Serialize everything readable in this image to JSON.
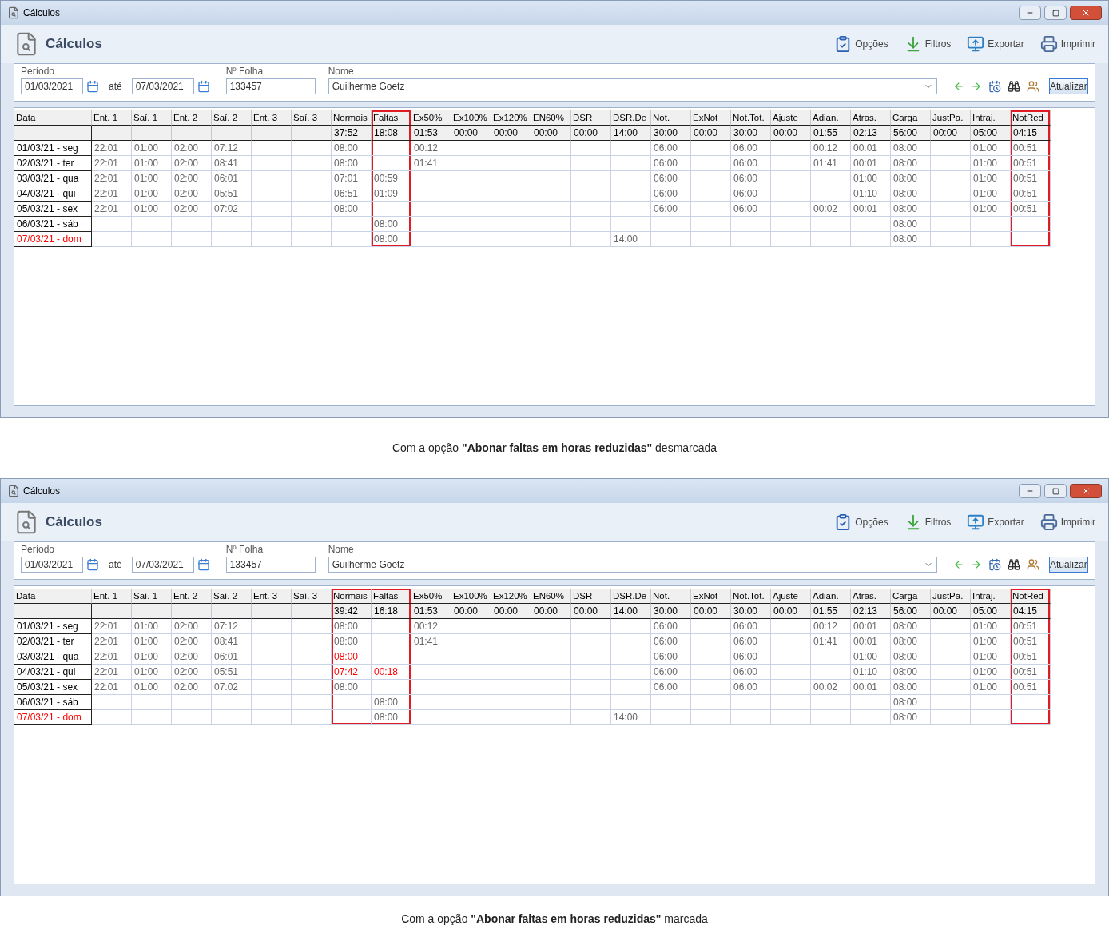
{
  "panels": [
    {
      "window": {
        "title": "Cálculos"
      },
      "header": {
        "title": "Cálculos"
      },
      "toolbar": [
        {
          "label": "Opções"
        },
        {
          "label": "Filtros"
        },
        {
          "label": "Exportar"
        },
        {
          "label": "Imprimir"
        }
      ],
      "filters": {
        "period_label": "Período",
        "start": "01/03/2021",
        "until": "até",
        "end": "07/03/2021",
        "sheet_label": "Nº Folha",
        "sheet": "133457",
        "name_label": "Nome",
        "name": "Guilherme Goetz"
      },
      "update_button": "Atualizar",
      "table": {
        "columns": [
          {
            "label": "Data",
            "highlighted": false
          },
          {
            "label": "Ent. 1",
            "highlighted": false
          },
          {
            "label": "Saí. 1",
            "highlighted": false
          },
          {
            "label": "Ent. 2",
            "highlighted": false
          },
          {
            "label": "Saí. 2",
            "highlighted": false
          },
          {
            "label": "Ent. 3",
            "highlighted": false
          },
          {
            "label": "Saí. 3",
            "highlighted": false
          },
          {
            "label": "Normais",
            "highlighted": false
          },
          {
            "label": "Faltas",
            "highlighted": true
          },
          {
            "label": "Ex50%",
            "highlighted": false
          },
          {
            "label": "Ex100%",
            "highlighted": false
          },
          {
            "label": "Ex120%",
            "highlighted": false
          },
          {
            "label": "EN60%",
            "highlighted": false
          },
          {
            "label": "DSR",
            "highlighted": false
          },
          {
            "label": "DSR.De",
            "highlighted": false
          },
          {
            "label": "Not.",
            "highlighted": false
          },
          {
            "label": "ExNot",
            "highlighted": false
          },
          {
            "label": "Not.Tot.",
            "highlighted": false
          },
          {
            "label": "Ajuste",
            "highlighted": false
          },
          {
            "label": "Adian.",
            "highlighted": false
          },
          {
            "label": "Atras.",
            "highlighted": false
          },
          {
            "label": "Carga",
            "highlighted": false
          },
          {
            "label": "JustPa.",
            "highlighted": false
          },
          {
            "label": "Intraj.",
            "highlighted": false
          },
          {
            "label": "NotRed",
            "highlighted": true
          }
        ],
        "totals": [
          "37:52",
          "18:08",
          "01:53",
          "00:00",
          "00:00",
          "00:00",
          "00:00",
          "14:00",
          "30:00",
          "00:00",
          "30:00",
          "00:00",
          "01:55",
          "02:13",
          "56:00",
          "00:00",
          "05:00",
          "04:15"
        ],
        "rows": [
          {
            "cells": [
              "01/03/21 - seg",
              "22:01",
              "01:00",
              "02:00",
              "07:12",
              "",
              "",
              "08:00",
              "",
              "00:12",
              "",
              "",
              "",
              "",
              "",
              "06:00",
              "",
              "06:00",
              "",
              "00:12",
              "00:01",
              "08:00",
              "",
              "01:00",
              "00:51"
            ]
          },
          {
            "cells": [
              "02/03/21 - ter",
              "22:01",
              "01:00",
              "02:00",
              "08:41",
              "",
              "",
              "08:00",
              "",
              "01:41",
              "",
              "",
              "",
              "",
              "",
              "06:00",
              "",
              "06:00",
              "",
              "01:41",
              "00:01",
              "08:00",
              "",
              "01:00",
              "00:51"
            ]
          },
          {
            "cells": [
              "03/03/21 - qua",
              "22:01",
              "01:00",
              "02:00",
              "06:01",
              "",
              "",
              "07:01",
              "00:59",
              "",
              "",
              "",
              "",
              "",
              "",
              "06:00",
              "",
              "06:00",
              "",
              "",
              "01:00",
              "08:00",
              "",
              "01:00",
              "00:51"
            ]
          },
          {
            "cells": [
              "04/03/21 - qui",
              "22:01",
              "01:00",
              "02:00",
              "05:51",
              "",
              "",
              "06:51",
              "01:09",
              "",
              "",
              "",
              "",
              "",
              "",
              "06:00",
              "",
              "06:00",
              "",
              "",
              "01:10",
              "08:00",
              "",
              "01:00",
              "00:51"
            ]
          },
          {
            "cells": [
              "05/03/21 - sex",
              "22:01",
              "01:00",
              "02:00",
              "07:02",
              "",
              "",
              "08:00",
              "",
              "",
              "",
              "",
              "",
              "",
              "",
              "06:00",
              "",
              "06:00",
              "",
              "00:02",
              "00:01",
              "08:00",
              "",
              "01:00",
              "00:51"
            ]
          },
          {
            "cells": [
              "06/03/21 - sáb",
              "",
              "",
              "",
              "",
              "",
              "",
              "",
              "08:00",
              "",
              "",
              "",
              "",
              "",
              "",
              "",
              "",
              "",
              "",
              "",
              "",
              "08:00",
              "",
              "",
              ""
            ]
          },
          {
            "cells": [
              {
                "text": "07/03/21 - dom",
                "alert": true
              },
              "",
              "",
              "",
              "",
              "",
              "",
              "",
              "08:00",
              "",
              "",
              "",
              "",
              "",
              "14:00",
              "",
              "",
              "",
              "",
              "",
              "",
              "08:00",
              "",
              "",
              ""
            ]
          }
        ]
      },
      "caption": "Com a opção **\"Abonar faltas em horas reduzidas\"** desmarcada"
    },
    {
      "window": {
        "title": "Cálculos"
      },
      "header": {
        "title": "Cálculos"
      },
      "toolbar": [
        {
          "label": "Opções"
        },
        {
          "label": "Filtros"
        },
        {
          "label": "Exportar"
        },
        {
          "label": "Imprimir"
        }
      ],
      "filters": {
        "period_label": "Período",
        "start": "01/03/2021",
        "until": "até",
        "end": "07/03/2021",
        "sheet_label": "Nº Folha",
        "sheet": "133457",
        "name_label": "Nome",
        "name": "Guilherme Goetz"
      },
      "update_button": "Atualizar",
      "table": {
        "columns": [
          {
            "label": "Data",
            "highlighted": false
          },
          {
            "label": "Ent. 1",
            "highlighted": false
          },
          {
            "label": "Saí. 1",
            "highlighted": false
          },
          {
            "label": "Ent. 2",
            "highlighted": false
          },
          {
            "label": "Saí. 2",
            "highlighted": false
          },
          {
            "label": "Ent. 3",
            "highlighted": false
          },
          {
            "label": "Saí. 3",
            "highlighted": false
          },
          {
            "label": "Normais",
            "highlighted": true
          },
          {
            "label": "Faltas",
            "highlighted": true
          },
          {
            "label": "Ex50%",
            "highlighted": false
          },
          {
            "label": "Ex100%",
            "highlighted": false
          },
          {
            "label": "Ex120%",
            "highlighted": false
          },
          {
            "label": "EN60%",
            "highlighted": false
          },
          {
            "label": "DSR",
            "highlighted": false
          },
          {
            "label": "DSR.De",
            "highlighted": false
          },
          {
            "label": "Not.",
            "highlighted": false
          },
          {
            "label": "ExNot",
            "highlighted": false
          },
          {
            "label": "Not.Tot.",
            "highlighted": false
          },
          {
            "label": "Ajuste",
            "highlighted": false
          },
          {
            "label": "Adian.",
            "highlighted": false
          },
          {
            "label": "Atras.",
            "highlighted": false
          },
          {
            "label": "Carga",
            "highlighted": false
          },
          {
            "label": "JustPa.",
            "highlighted": false
          },
          {
            "label": "Intraj.",
            "highlighted": false
          },
          {
            "label": "NotRed",
            "highlighted": true
          }
        ],
        "totals": [
          "39:42",
          "16:18",
          "01:53",
          "00:00",
          "00:00",
          "00:00",
          "00:00",
          "14:00",
          "30:00",
          "00:00",
          "30:00",
          "00:00",
          "01:55",
          "02:13",
          "56:00",
          "00:00",
          "05:00",
          "04:15"
        ],
        "rows": [
          {
            "cells": [
              "01/03/21 - seg",
              "22:01",
              "01:00",
              "02:00",
              "07:12",
              "",
              "",
              "08:00",
              "",
              "00:12",
              "",
              "",
              "",
              "",
              "",
              "06:00",
              "",
              "06:00",
              "",
              "00:12",
              "00:01",
              "08:00",
              "",
              "01:00",
              "00:51"
            ]
          },
          {
            "cells": [
              "02/03/21 - ter",
              "22:01",
              "01:00",
              "02:00",
              "08:41",
              "",
              "",
              "08:00",
              "",
              "01:41",
              "",
              "",
              "",
              "",
              "",
              "06:00",
              "",
              "06:00",
              "",
              "01:41",
              "00:01",
              "08:00",
              "",
              "01:00",
              "00:51"
            ]
          },
          {
            "cells": [
              "03/03/21 - qua",
              "22:01",
              "01:00",
              "02:00",
              "06:01",
              "",
              "",
              {
                "text": "08:00",
                "alert": true
              },
              "",
              "",
              "",
              "",
              "",
              "",
              "",
              "06:00",
              "",
              "06:00",
              "",
              "",
              "01:00",
              "08:00",
              "",
              "01:00",
              "00:51"
            ]
          },
          {
            "cells": [
              "04/03/21 - qui",
              "22:01",
              "01:00",
              "02:00",
              "05:51",
              "",
              "",
              {
                "text": "07:42",
                "alert": true
              },
              {
                "text": "00:18",
                "alert": true
              },
              "",
              "",
              "",
              "",
              "",
              "",
              "06:00",
              "",
              "06:00",
              "",
              "",
              "01:10",
              "08:00",
              "",
              "01:00",
              "00:51"
            ]
          },
          {
            "cells": [
              "05/03/21 - sex",
              "22:01",
              "01:00",
              "02:00",
              "07:02",
              "",
              "",
              "08:00",
              "",
              "",
              "",
              "",
              "",
              "",
              "",
              "06:00",
              "",
              "06:00",
              "",
              "00:02",
              "00:01",
              "08:00",
              "",
              "01:00",
              "00:51"
            ]
          },
          {
            "cells": [
              "06/03/21 - sáb",
              "",
              "",
              "",
              "",
              "",
              "",
              "",
              "08:00",
              "",
              "",
              "",
              "",
              "",
              "",
              "",
              "",
              "",
              "",
              "",
              "",
              "08:00",
              "",
              "",
              ""
            ]
          },
          {
            "cells": [
              {
                "text": "07/03/21 - dom",
                "alert": true
              },
              "",
              "",
              "",
              "",
              "",
              "",
              "",
              "08:00",
              "",
              "",
              "",
              "",
              "",
              "14:00",
              "",
              "",
              "",
              "",
              "",
              "",
              "08:00",
              "",
              "",
              ""
            ]
          }
        ]
      },
      "caption": "Com a opção **\"Abonar faltas em horas reduzidas\"** marcada"
    }
  ]
}
